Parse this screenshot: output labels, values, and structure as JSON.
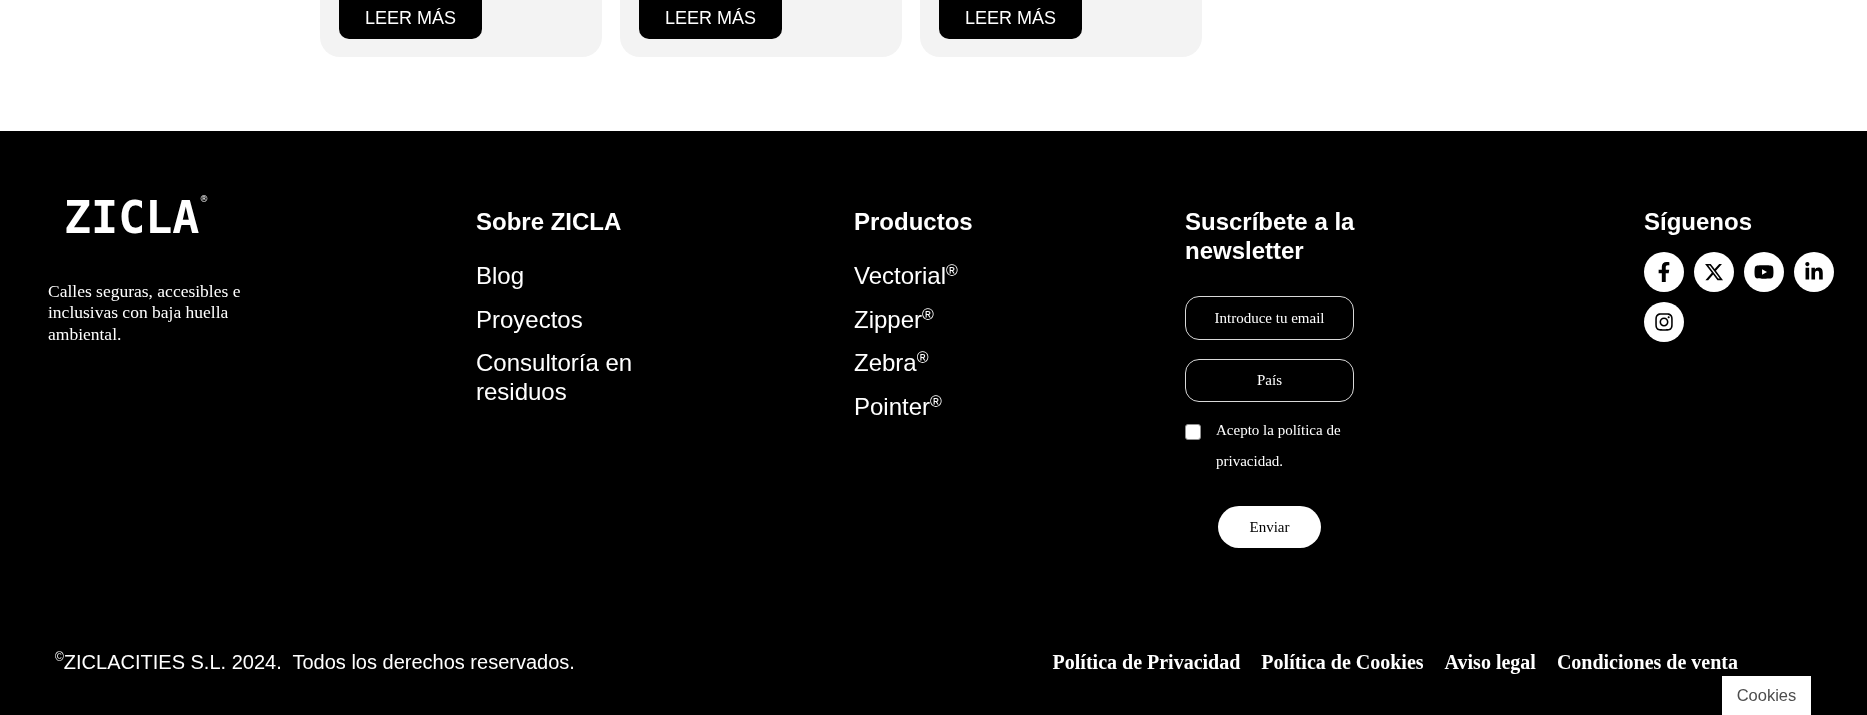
{
  "cards": [
    {
      "button": "LEER MÁS"
    },
    {
      "button": "LEER MÁS"
    },
    {
      "button": "LEER MÁS"
    }
  ],
  "footer": {
    "logo": "ZICLA$^{®}$",
    "tagline": "Calles seguras, accesibles e inclusivas con baja huella ambiental.",
    "columns": [
      {
        "heading": "Sobre ZICLA",
        "links": [
          "Blog",
          "Proyectos",
          "Consultoría en residuos"
        ]
      },
      {
        "heading": "Productos",
        "links": [
          "Vectorial$^{®}$",
          "Zipper$^{®}$",
          "Zebra$^{®}$",
          "Pointer$^{®}$"
        ]
      }
    ],
    "newsletter": {
      "heading": "Suscríbete a la newsletter",
      "fields": [
        {
          "placeholder": "Introduce tu email"
        },
        {
          "placeholder": "País"
        }
      ],
      "consent": {
        "label": "Acepto la política de privacidad.",
        "checked": false
      },
      "button": "Enviar"
    },
    "social": {
      "heading": "Síguenos",
      "links": [
        {
          "kind": "facebook"
        },
        {
          "kind": "x"
        },
        {
          "kind": "youtube"
        },
        {
          "kind": "linkedin"
        },
        {
          "kind": "instagram"
        }
      ]
    },
    "copyright": "$^{©}$ZICLACITIES S.L. 2024.  Todos los derechos reservados.",
    "legal_links": [
      "Política de Privacidad",
      "Política de Cookies",
      "Aviso legal",
      "Condiciones de venta"
    ]
  },
  "cookies_button": "Cookies"
}
